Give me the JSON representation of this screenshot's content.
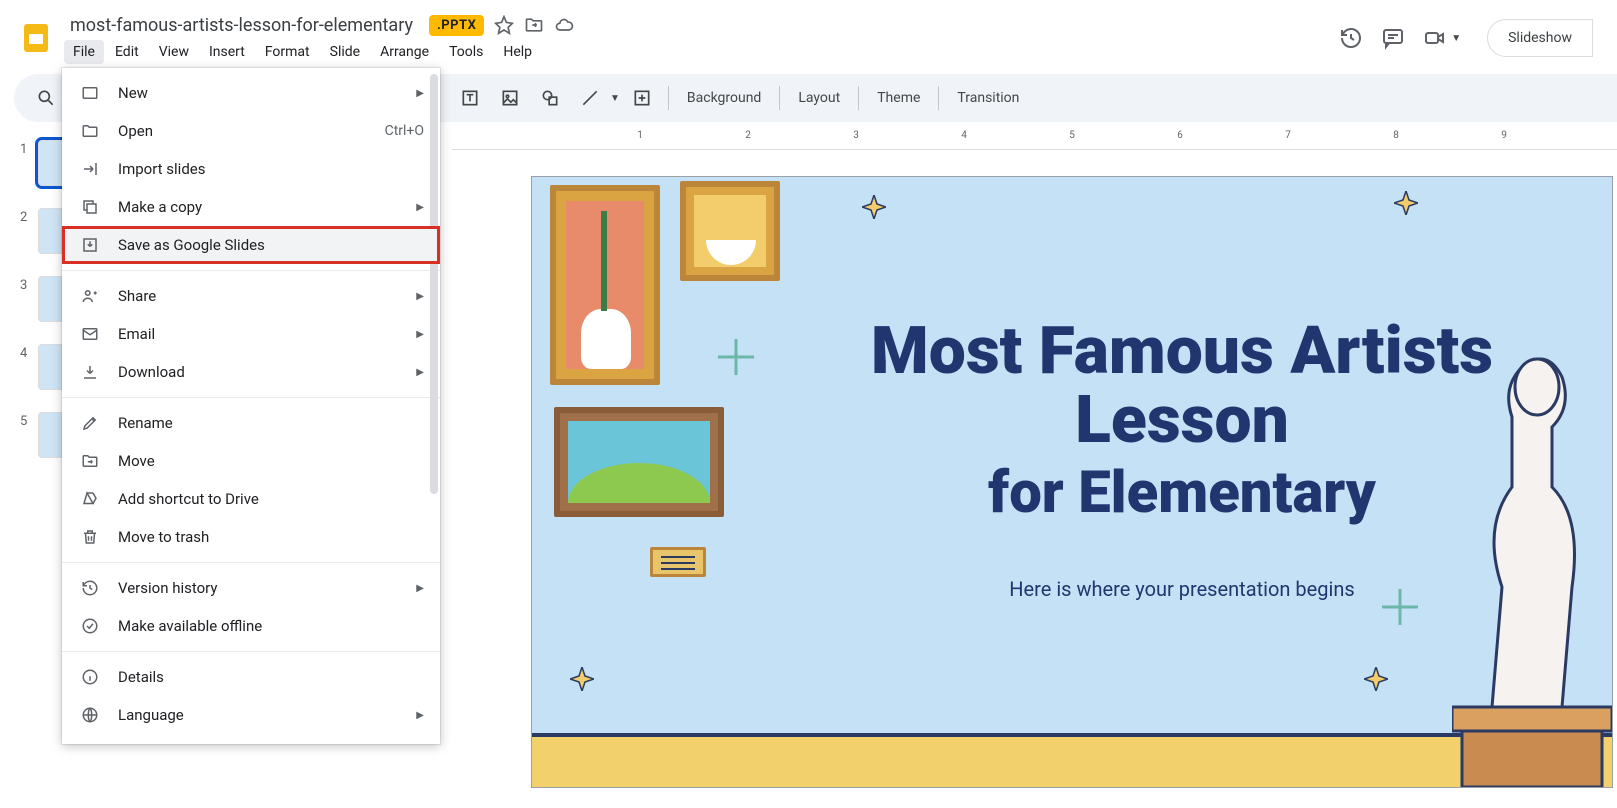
{
  "header": {
    "doc_title": "most-famous-artists-lesson-for-elementary",
    "badge": ".PPTX",
    "slideshow": "Slideshow"
  },
  "menubar": [
    "File",
    "Edit",
    "View",
    "Insert",
    "Format",
    "Slide",
    "Arrange",
    "Tools",
    "Help"
  ],
  "toolbar": {
    "background": "Background",
    "layout": "Layout",
    "theme": "Theme",
    "transition": "Transition"
  },
  "file_menu": {
    "new": "New",
    "open": "Open",
    "open_shortcut": "Ctrl+O",
    "import": "Import slides",
    "make_copy": "Make a copy",
    "save_as": "Save as Google Slides",
    "share": "Share",
    "email": "Email",
    "download": "Download",
    "rename": "Rename",
    "move": "Move",
    "add_shortcut": "Add shortcut to Drive",
    "trash": "Move to trash",
    "version": "Version history",
    "offline": "Make available offline",
    "details": "Details",
    "language": "Language"
  },
  "thumbs": [
    "1",
    "2",
    "3",
    "4",
    "5"
  ],
  "ruler_numbers": [
    "1",
    "2",
    "3",
    "4",
    "5",
    "6",
    "7",
    "8",
    "9"
  ],
  "slide": {
    "title_line1": "Most Famous Artists Lesson",
    "title_line2": "for Elementary",
    "subtitle": "Here is where your presentation begins"
  }
}
